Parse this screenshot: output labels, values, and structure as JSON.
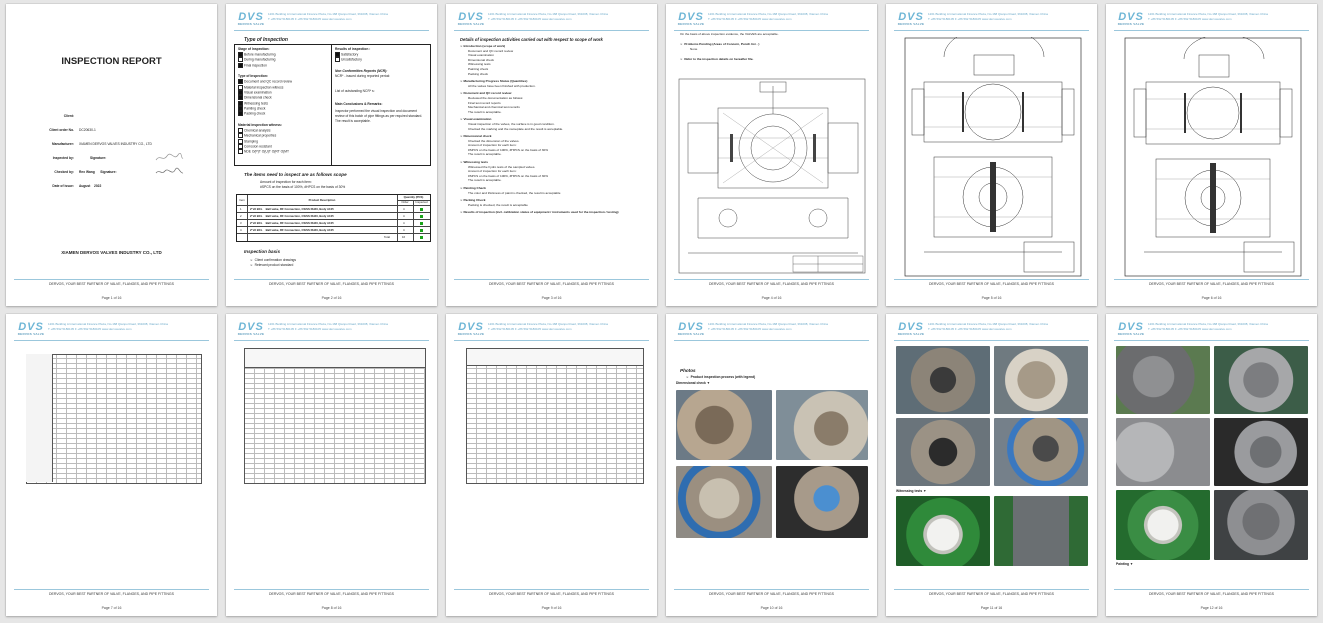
{
  "header": {
    "logo_text": "DVS",
    "logo_sub": "DERVOS VALVE",
    "address_line1": "1201 Building A International Finance Plaza, No.168 Qianpu Road, 361008, Xiamen China",
    "address_line2": "T +86 592 5180105    F +86 592 5180105    www.dervosvalve.com"
  },
  "footer_text": "DERVOS, YOUR BEST PARTNER OF VALVE, FLANGES, AND PIPE FITTINGS",
  "pages": [
    {
      "page_no": "Page 1 of 16"
    },
    {
      "page_no": "Page 2 of 16"
    },
    {
      "page_no": "Page 3 of 16"
    },
    {
      "page_no": "Page 4 of 16"
    },
    {
      "page_no": "Page 5 of 16"
    },
    {
      "page_no": "Page 6 of 16"
    },
    {
      "page_no": "Page 7 of 16"
    },
    {
      "page_no": "Page 8 of 16"
    },
    {
      "page_no": "Page 9 of 16"
    },
    {
      "page_no": "Page 10 of 16"
    },
    {
      "page_no": "Page 11 of 16"
    },
    {
      "page_no": "Page 12 of 16"
    }
  ],
  "p1": {
    "title": "INSPECTION REPORT",
    "fields": [
      {
        "label": "Client:",
        "value": ""
      },
      {
        "label": "Client order No.",
        "value": "DC20630-1"
      },
      {
        "label": "Manufacturer:",
        "value": "XIAMEN DERVOS VALVES INDUSTRY CO., LTD"
      },
      {
        "label": "Inspected by:",
        "value": "Signature:"
      },
      {
        "label": "Checked by:",
        "value": "Rex Wang      Signature:"
      },
      {
        "label": "Date of issue:",
        "value": "August    2022"
      }
    ],
    "company": "XIAMEN DERVOS VALVES INDUSTRY CO., LTD"
  },
  "p2": {
    "type_title": "Type of Inspection",
    "stage_title": "Stage of Inspection:",
    "stage_items": [
      "Before manufacturing",
      "During manufacturing",
      "Final inspection"
    ],
    "result_title": "Results of inspection :",
    "result_items": [
      "Satisfactory",
      "Unsatisfactory"
    ],
    "type2_title": "Type of Inspection:",
    "type2_items": [
      "Document and QC record review",
      "Material inspection witness",
      "Visual examination",
      "Dimensional check",
      "Witnessing tests",
      "Painting check",
      "Packing check"
    ],
    "ncr_title": "Non Conformities Reports (NCR):",
    "ncr_items": [
      "NCR* - issued during reported period:",
      "List of outstanding NCR* s:"
    ],
    "witness_title": "Material inspection witness:",
    "witness_items": [
      "Chemical analysis",
      "Mechanical properties",
      "Stamping",
      "Corrosion resistant",
      "NDE  O(P)T  O(U)T  O(RT  O(MT"
    ],
    "conclusion_title": "Main Conclusions & Remarks:",
    "conclusion_text": "Inspector performed the visual inspection and document review of this batch of pipe fittings as per required standard. The result is acceptable.",
    "scope_title": "The items need to inspect are as follows scope",
    "scope_line1": "Amount of inspection for each item:",
    "scope_line2": "#SPCS on the basis of 100%,    #HPCS on the basis of 30%",
    "table_headers": [
      "Item",
      "Product Description",
      "Quantity (PCS)",
      "Order",
      "Inspected"
    ],
    "table_rows": [
      {
        "item": "1",
        "desc": "2\"x6 BCL    Ball valve, RF Connection, CS/SS RH40, Body A105",
        "order": "4",
        "ins": ""
      },
      {
        "item": "2",
        "desc": "2\"x6 BCL    Ball valve, RF Connection, CS/SS RH40, Body A105",
        "order": "4",
        "ins": ""
      },
      {
        "item": "3",
        "desc": "2\"x6 BCL    Ball valve, RF Connection, CS/SS RH40, Body A105",
        "order": "4",
        "ins": ""
      },
      {
        "item": "4",
        "desc": "2\"x6 BCL    Ball valve, RF Connection, CS/SS RH40, Body A105",
        "order": "4",
        "ins": ""
      }
    ],
    "total_label": "Total",
    "total_value": "16",
    "basis_title": "Inspection basis",
    "basis_items": [
      "Client confirmation drawings",
      "Relevant product standard"
    ]
  },
  "p3": {
    "title": "Details of inspection activities carried out with respect to scope of work",
    "sections": [
      {
        "head": "Introduction (scope of work)",
        "lines": [
          "Document and QC record review",
          "Visual examination",
          "Dimensional check",
          "Witnessing tests",
          "Painting check",
          "Packing check"
        ]
      },
      {
        "head": "Manufacturing Progress Status (Quantities)",
        "lines": [
          "All the valves have been finished with production."
        ]
      },
      {
        "head": "Document and QC record review",
        "lines": [
          "Reviewed the documentation as follows:",
          "Final test record reports",
          "Mechanical and chemical test records",
          "The result is acceptable."
        ]
      },
      {
        "head": "Visual examination",
        "lines": [
          "Visual inspection of the valves, the surface is in good condition.",
          "Checked the marking and the nameplate and the result is acceptable."
        ]
      },
      {
        "head": "Dimensional check",
        "lines": [
          "Checked the dimension of the valves.",
          "Amount of inspection for each item:",
          "#SPCS on the basis of 100%,   #HPCS on the basis of 30%",
          "The result is acceptable."
        ]
      },
      {
        "head": "Witnessing tests",
        "lines": [
          "Witnessed the hydro tests of the sampled valves.",
          "Amount of inspection for each item:",
          "#SPCS on the basis of 100%,   #HPCS on the basis of 30%",
          "The result is acceptable."
        ]
      },
      {
        "head": "Painting Check",
        "lines": [
          "The color and thickness of paint is checked, the result is acceptable"
        ]
      },
      {
        "head": "Packing Check",
        "lines": [
          "Packing is checked, the result is acceptable"
        ]
      },
      {
        "head": "Results of inspection (incl. calibration status of equipment / instruments used for the inspection / testing)",
        "lines": []
      }
    ]
  },
  "p4": {
    "intro": "On the basis of above inspection evidence, the VALVES are acceptable.",
    "problems": "Problems Pending (Areas of Concern, Punch list - )",
    "problems_val": "None",
    "refer": "Refer to the inspection details on hereafter file."
  },
  "p10": {
    "title": "Photos",
    "sub": "Product inspection process (with legend)",
    "cap": "Dimensional check"
  },
  "p11": {
    "cap": "Witnessing tests"
  },
  "p12": {
    "cap": "Painting"
  }
}
